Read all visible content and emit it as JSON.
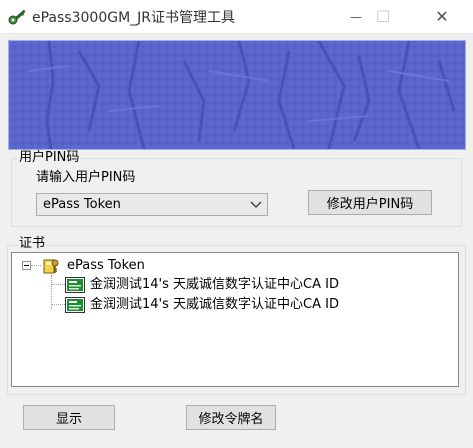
{
  "window": {
    "title": "ePass3000GM_JR证书管理工具",
    "minimize_glyph": "—",
    "maximize_glyph": "☐",
    "close_glyph": "✕"
  },
  "pin_group": {
    "label": "用户PIN码",
    "prompt": "请输入用户PIN码",
    "token_select": {
      "selected": "ePass Token"
    },
    "change_pin_label": "修改用户PIN码"
  },
  "cert_group": {
    "label": "证书",
    "tree": {
      "root": {
        "label": "ePass Token",
        "icon": "token-key-icon",
        "expanded": true
      },
      "children": [
        {
          "label": "金润测试14's 天威诚信数字认证中心CA ID",
          "icon": "certificate-icon"
        },
        {
          "label": "金润测试14's 天威诚信数字认证中心CA ID",
          "icon": "certificate-icon"
        }
      ]
    }
  },
  "footer": {
    "show_label": "显示",
    "change_token_name_label": "修改令牌名"
  },
  "colors": {
    "banner": "#5560c8",
    "window_bg": "#f0f0f0"
  }
}
